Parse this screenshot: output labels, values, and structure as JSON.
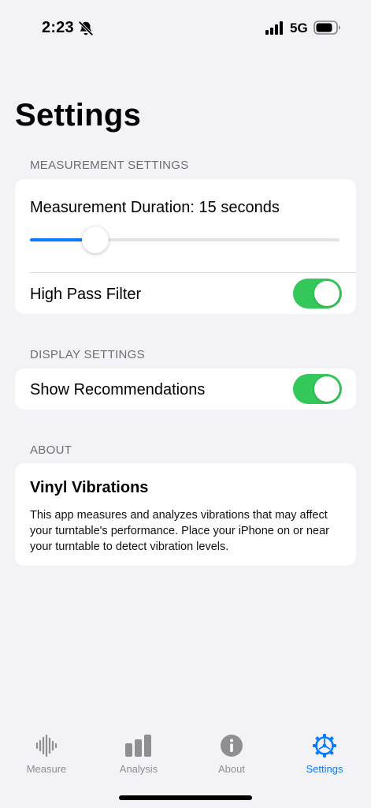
{
  "status_bar": {
    "time": "2:23",
    "network": "5G",
    "icons": [
      "bell-slash-icon",
      "signal-icon",
      "battery-icon"
    ]
  },
  "page": {
    "title": "Settings"
  },
  "sections": {
    "measurement": {
      "header": "MEASUREMENT SETTINGS",
      "duration_label": "Measurement Duration: 15 seconds",
      "duration_slider_fraction": 0.21,
      "high_pass_label": "High Pass Filter",
      "high_pass_on": true
    },
    "display": {
      "header": "DISPLAY SETTINGS",
      "recommendations_label": "Show Recommendations",
      "recommendations_on": true
    },
    "about": {
      "header": "ABOUT",
      "app_name": "Vinyl Vibrations",
      "description": "This app measures and analyzes vibrations that may affect your turntable's performance. Place your iPhone on or near your turntable to detect vibration levels."
    }
  },
  "tab_bar": {
    "tabs": [
      {
        "label": "Measure",
        "icon": "waveform-icon",
        "active": false
      },
      {
        "label": "Analysis",
        "icon": "bar-chart-icon",
        "active": false
      },
      {
        "label": "About",
        "icon": "info-icon",
        "active": false
      },
      {
        "label": "Settings",
        "icon": "gear-icon",
        "active": true
      }
    ]
  },
  "colors": {
    "accent": "#0a7aff",
    "toggle_on": "#34c759",
    "background": "#f2f2f7",
    "inactive_tab": "#8e8e93"
  }
}
